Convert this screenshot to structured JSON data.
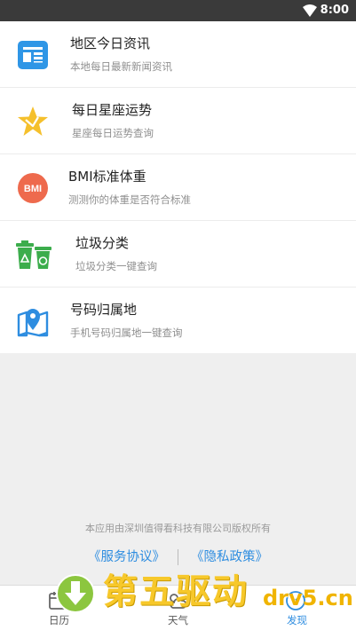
{
  "status_bar": {
    "time": "8:00",
    "wifi_icon": "wifi-icon"
  },
  "items": [
    {
      "icon": "news-icon",
      "title": "地区今日资讯",
      "subtitle": "本地每日最新新闻资讯"
    },
    {
      "icon": "star-icon",
      "title": "每日星座运势",
      "subtitle": "星座每日运势查询"
    },
    {
      "icon": "bmi-icon",
      "badge": "BMI",
      "title": "BMI标准体重",
      "subtitle": "测测你的体重是否符合标准"
    },
    {
      "icon": "trash-bin-icon",
      "title": "垃圾分类",
      "subtitle": "垃圾分类一键查询"
    },
    {
      "icon": "map-location-icon",
      "title": "号码归属地",
      "subtitle": "手机号码归属地一键查询"
    }
  ],
  "footer": {
    "copyright": "本应用由深圳值得看科技有限公司版权所有",
    "service_link": "《服务协议》",
    "privacy_link": "《隐私政策》"
  },
  "tabs": [
    {
      "icon": "calendar-icon",
      "label": "日历",
      "active": false
    },
    {
      "icon": "weather-icon",
      "label": "天气",
      "active": false
    },
    {
      "icon": "discover-icon",
      "label": "发现",
      "active": true
    }
  ],
  "watermark": {
    "text": "第五驱动",
    "domain": "drv5.cn"
  },
  "colors": {
    "accent": "#2e8de0",
    "star": "#f5c02c",
    "bmi": "#ee6a4d",
    "trash": "#3cad4c",
    "status_bar": "#3a3a3a"
  }
}
